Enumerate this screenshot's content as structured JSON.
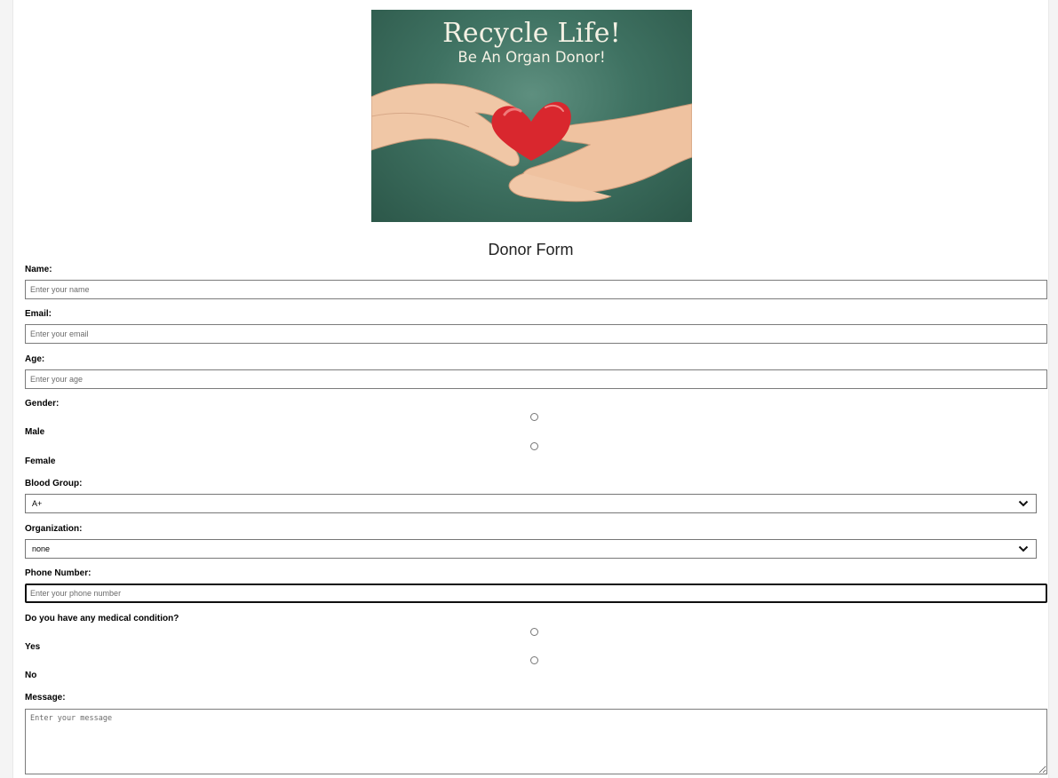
{
  "banner": {
    "headline": "Recycle Life!",
    "subline": "Be An Organ Donor!"
  },
  "form": {
    "title": "Donor Form",
    "name": {
      "label": "Name:",
      "placeholder": "Enter your name"
    },
    "email": {
      "label": "Email:",
      "placeholder": "Enter your email"
    },
    "age": {
      "label": "Age:",
      "placeholder": "Enter your age"
    },
    "gender": {
      "label": "Gender:",
      "options": [
        "Male",
        "Female"
      ]
    },
    "blood_group": {
      "label": "Blood Group:",
      "selected": "A+"
    },
    "organization": {
      "label": "Organization:",
      "selected": "none"
    },
    "phone": {
      "label": "Phone Number:",
      "placeholder": "Enter your phone number"
    },
    "medical": {
      "label": "Do you have any medical condition?",
      "options": [
        "Yes",
        "No"
      ]
    },
    "message": {
      "label": "Message:",
      "placeholder": "Enter your message"
    }
  },
  "colors": {
    "banner_bg": "#3f7262",
    "heart": "#d9272e",
    "focus_border": "#101010"
  }
}
